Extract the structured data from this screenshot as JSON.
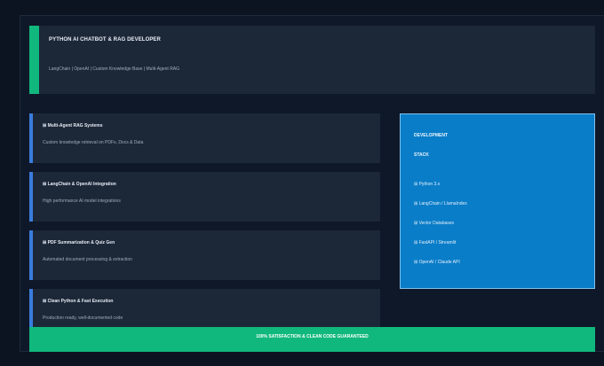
{
  "header": {
    "title": "PYTHON AI CHATBOT & RAG DEVELOPER",
    "subtitle": "LangChain | OpenAI | Custom Knowledge Base | Multi-Agent RAG"
  },
  "features": [
    {
      "title": "⊞ Multi-Agent RAG Systems",
      "description": "Custom knowledge retrieval on PDFs, Docs & Data"
    },
    {
      "title": "⊞ LangChain & OpenAI Integration",
      "description": "High performance AI model integrations"
    },
    {
      "title": "⊞ PDF Summarization & Quiz Gen",
      "description": "Automated document processing & extraction"
    },
    {
      "title": "⊞ Clean Python & Fast Execution",
      "description": "Production ready, well-documented code"
    }
  ],
  "stack": {
    "heading_line1": "DEVELOPMENT",
    "heading_line2": "STACK",
    "items": [
      "⊞ Python 3.x",
      "⊞ LangChain / LlamaIndex",
      "⊞ Vector Databases",
      "⊞ FastAPI / Streamlit",
      "⊞ OpenAI / Claude API"
    ]
  },
  "banner": {
    "text": "100% SATISFACTION & CLEAN CODE GUARANTEED"
  },
  "colors": {
    "background": "#0c1422",
    "card": "#1c2738",
    "green_accent": "#11b87e",
    "blue_accent": "#3b7cdd",
    "stack_card": "#0a7dc8"
  }
}
